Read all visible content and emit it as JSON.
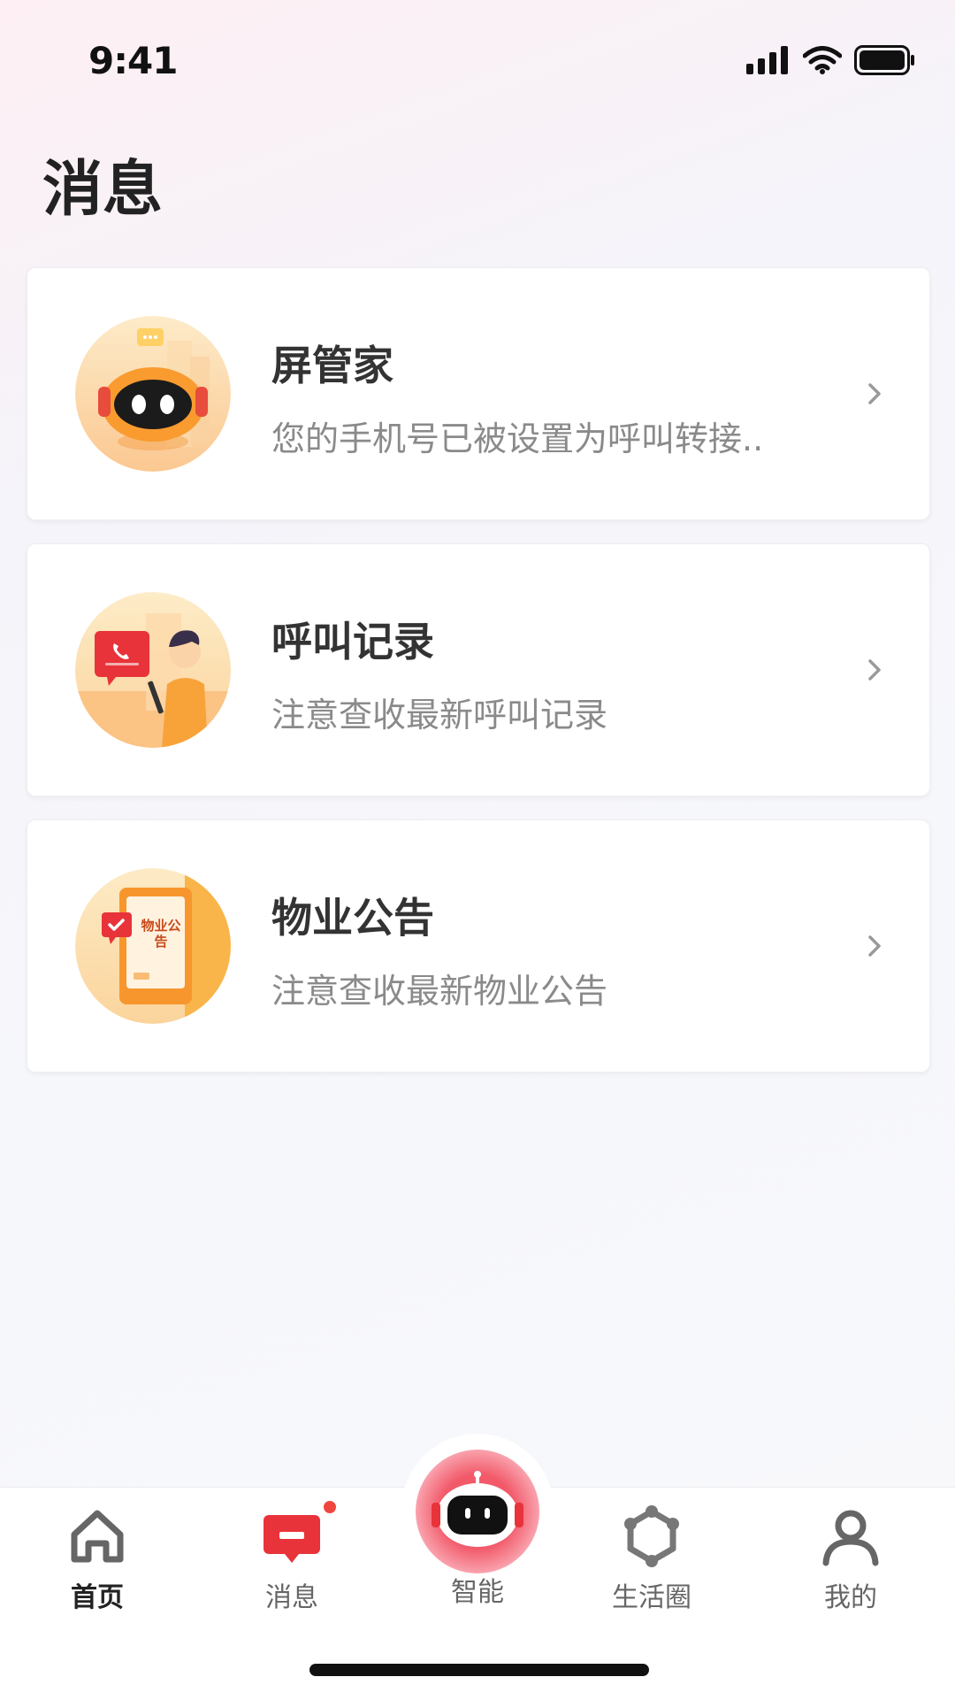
{
  "status_bar": {
    "time": "9:41"
  },
  "page_title": "消息",
  "cards": [
    {
      "title": "屏管家",
      "subtitle": "您的手机号已被设置为呼叫转接..",
      "avatar_icon": "robot-icon"
    },
    {
      "title": "呼叫记录",
      "subtitle": "注意查收最新呼叫记录",
      "avatar_icon": "call-record-icon"
    },
    {
      "title": "物业公告",
      "subtitle": "注意查收最新物业公告",
      "avatar_icon": "announcement-icon",
      "avatar_text": "物业公告"
    }
  ],
  "tabbar": {
    "items": [
      {
        "label": "首页",
        "icon": "home-icon",
        "active": true
      },
      {
        "label": "消息",
        "icon": "message-icon",
        "badge": true
      },
      {
        "label": "智能",
        "icon": "robot-icon"
      },
      {
        "label": "生活圈",
        "icon": "hexagon-network-icon"
      },
      {
        "label": "我的",
        "icon": "user-icon"
      }
    ]
  },
  "colors": {
    "accent": "#e8333a",
    "orange": "#f7a33a",
    "text_primary": "#333333",
    "text_secondary": "#8a8a8a"
  }
}
